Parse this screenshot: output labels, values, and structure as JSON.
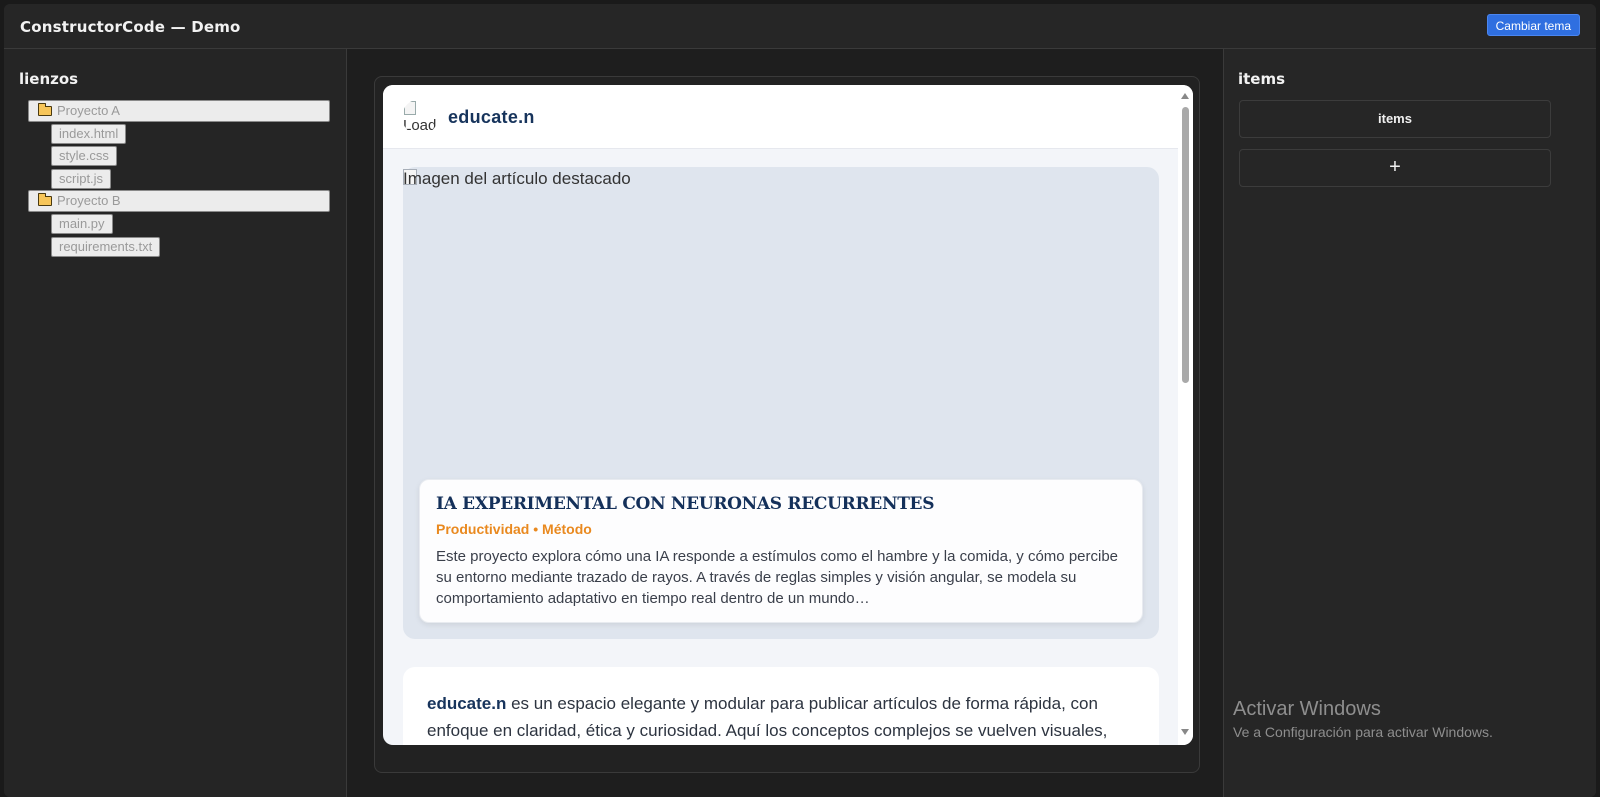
{
  "app": {
    "title": "ConstructorCode — Demo",
    "theme_button": "Cambiar tema"
  },
  "left": {
    "title": "lienzos",
    "tree": [
      {
        "folder": "Proyecto A",
        "files": [
          "index.html",
          "style.css",
          "script.js"
        ]
      },
      {
        "folder": "Proyecto B",
        "files": [
          "main.py",
          "requirements.txt"
        ]
      }
    ]
  },
  "preview": {
    "brand": "educate.n",
    "avatar_alt": "Load",
    "hero_alt": "Imagen del artículo destacado",
    "card": {
      "title": "IA EXPERIMENTAL CON NEURONAS RECURRENTES",
      "tags": "Productividad • Método",
      "text": "Este proyecto explora cómo una IA responde a estímulos como el hambre y la comida, y cómo percibe su entorno mediante trazado de rayos. A través de reglas simples y visión angular, se modela su comportamiento adaptativo en tiempo real dentro de un mundo…"
    },
    "about": {
      "brand": "educate.n",
      "text": " es un espacio elegante y modular para publicar artículos de forma rápida, con enfoque en claridad, ética y curiosidad. Aquí los conceptos complejos se vuelven visuales,"
    }
  },
  "right": {
    "title": "items",
    "items_button": "items",
    "add_button": "+"
  },
  "watermark": {
    "line1": "Activar Windows",
    "line2": "Ve a Configuración para activar Windows."
  },
  "colors": {
    "accent": "#2f6fe0",
    "brand_navy": "#17345c",
    "tag_orange": "#e9891f"
  }
}
